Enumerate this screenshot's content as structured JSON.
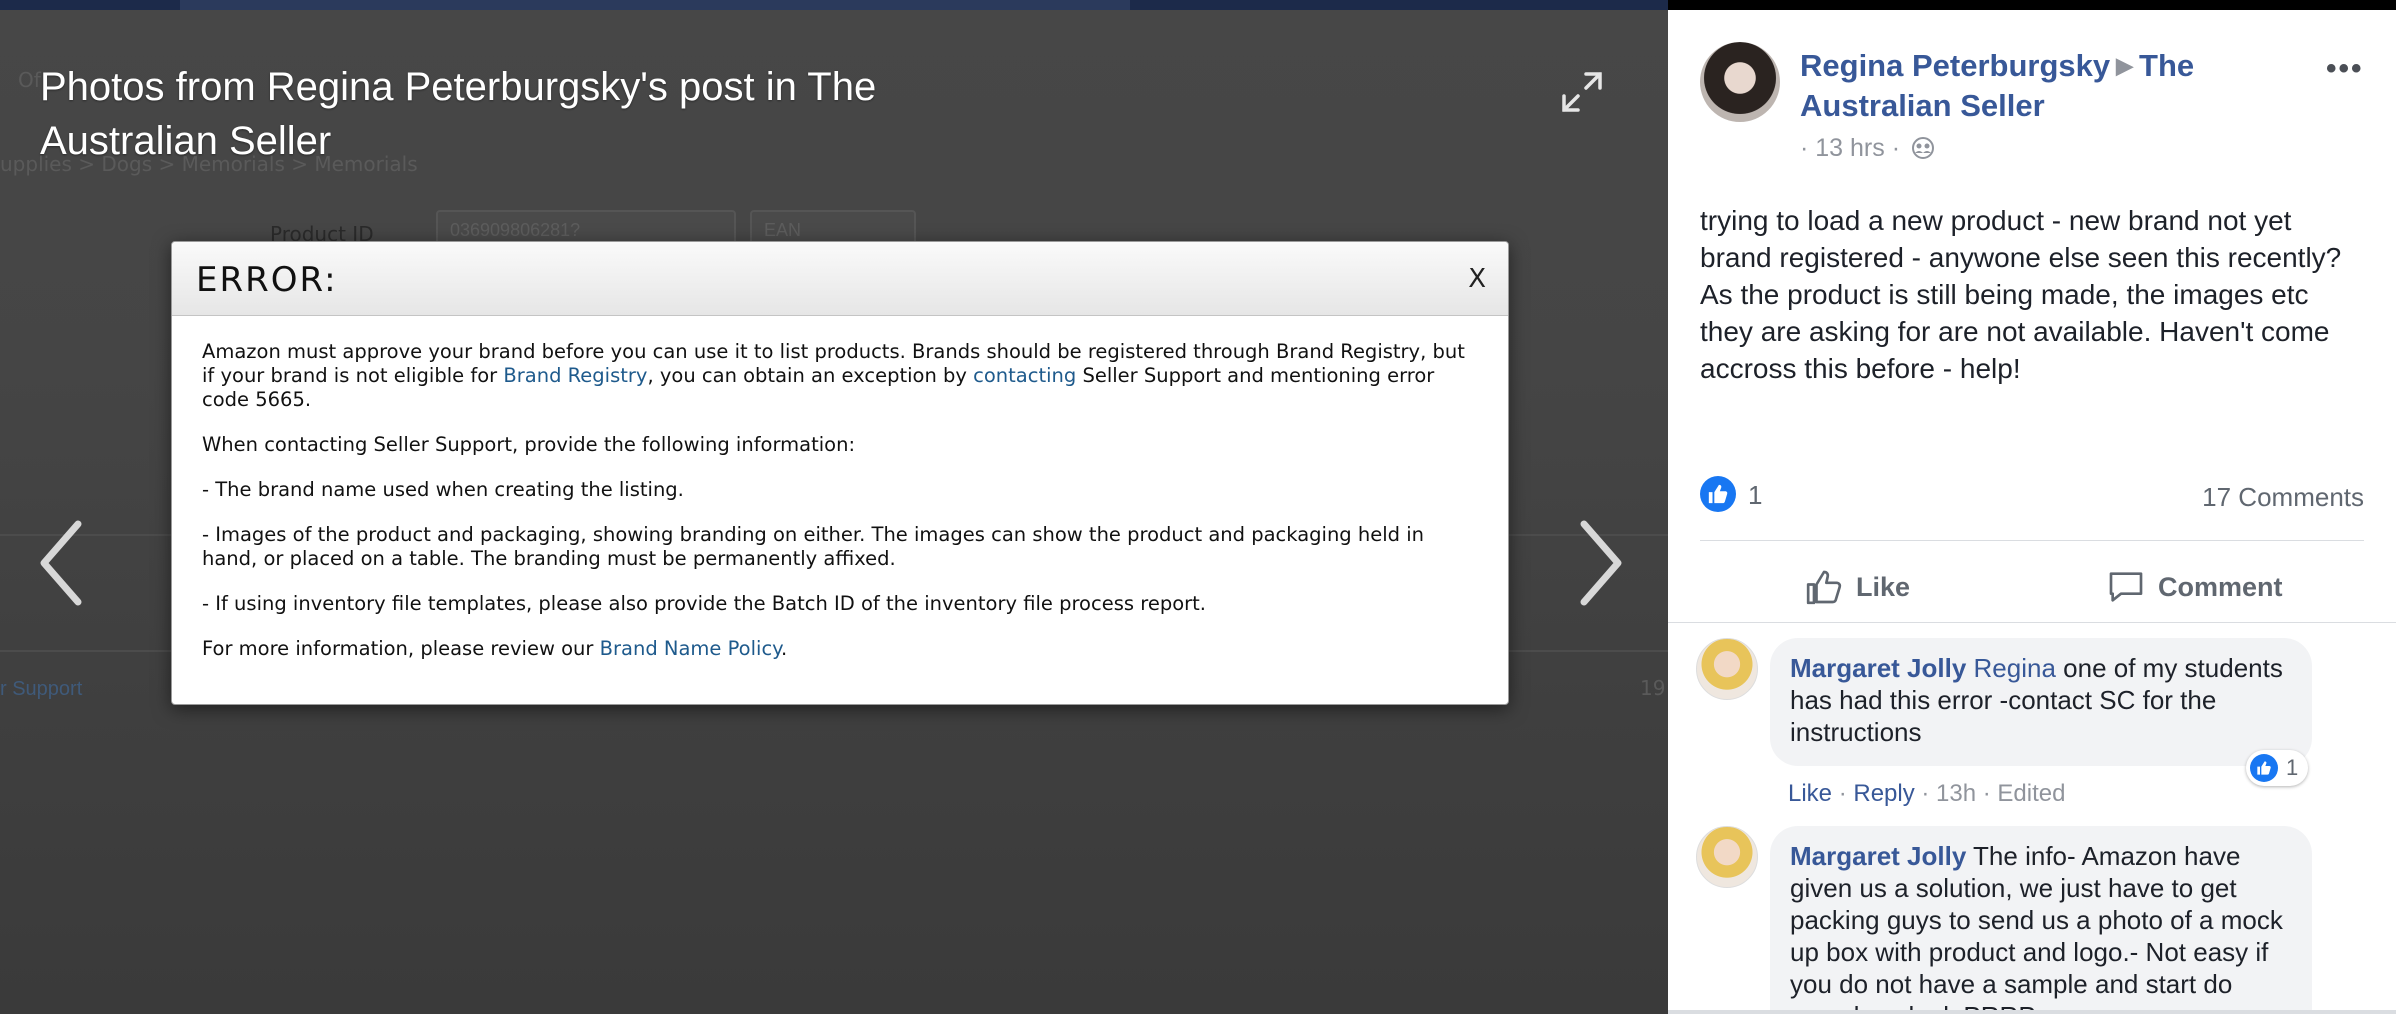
{
  "viewer": {
    "title": "Photos from Regina Peterburgsky's post in The Australian Seller"
  },
  "background": {
    "breadcrumb": "upplies  >  Dogs  >  Memorials  >  Memorials",
    "tab_fragment": "Of",
    "product_id_label": "Product ID",
    "product_id_value": "036909806281?",
    "id_type": "EAN",
    "support_link": "r Support",
    "right_fragment": "19"
  },
  "error_modal": {
    "title": "ERROR:",
    "close": "X",
    "p1_a": "Amazon must approve your brand before you can use it to list products. Brands should be registered through Brand Registry, but if your brand is not eligible for ",
    "p1_link1": "Brand Registry",
    "p1_b": ", you can obtain an exception by ",
    "p1_link2": "contacting",
    "p1_c": " Seller Support and mentioning error code 5665.",
    "p2": "When contacting Seller Support, provide the following information:",
    "p3": "- The brand name used when creating the listing.",
    "p4": "- Images of the product and packaging, showing branding on either. The images can show the product and packaging held in hand, or placed on a table. The branding must be permanently affixed.",
    "p5": "- If using inventory file templates, please also provide the Batch ID of the inventory file process report.",
    "p6_a": "For more information, please review our ",
    "p6_link": "Brand Name Policy",
    "p6_b": "."
  },
  "post": {
    "author": "Regina Peterburgsky",
    "group": "The Australian Seller",
    "time": "· 13 hrs ·",
    "more": "•••",
    "text": "trying to load a new product - new brand not yet brand registered - anywone else seen this recently? As the product is still being made, the images etc they are asking for are not available. Haven't come accross this before - help!",
    "reaction_count": "1",
    "comments_count": "17 Comments",
    "like_label": "Like",
    "comment_label": "Comment"
  },
  "comments": [
    {
      "author": "Margaret Jolly",
      "mention": "Regina",
      "text": " one of my students has had this error -contact SC for the instructions",
      "like": "Like",
      "reply": "Reply",
      "time": "13h",
      "edited": "Edited",
      "reactions": "1"
    },
    {
      "author": "Margaret Jolly",
      "text": " The info- Amazon have given us a solution, we just have to get packing guys to send us a photo of a mock up box with product and logo.- Not easy if you do not have a sample and start do somehow look PRRP"
    }
  ],
  "colors": {
    "facebook_link": "#385898",
    "like_blue": "#1877f2",
    "amazon_link": "#1e5a8c"
  }
}
